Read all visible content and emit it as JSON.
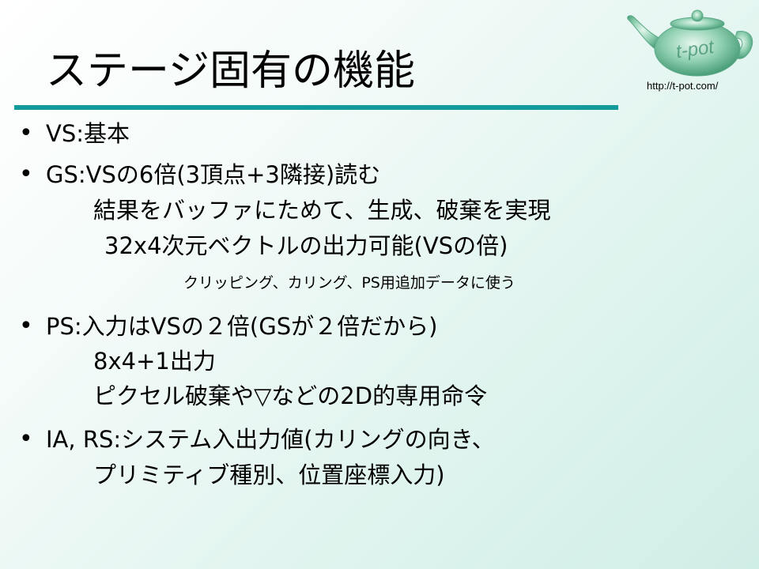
{
  "title": "ステージ固有の機能",
  "url": "http://t-pot.com/",
  "logo_text": "t-pot",
  "bullet_symbol": "•",
  "bullets": [
    {
      "lines": [
        "VS:基本"
      ]
    },
    {
      "lines": [
        "GS:VSの6倍(3頂点+3隣接)読む",
        "結果をバッファにためて、生成、破棄を実現",
        "32x4次元ベクトルの出力可能(VSの倍)",
        "クリッピング、カリング、PS用追加データに使う"
      ]
    },
    {
      "lines": [
        "PS:入力はVSの２倍(GSが２倍だから)",
        "8x4+1出力",
        "ピクセル破棄や▽などの2D的専用命令"
      ]
    },
    {
      "lines": [
        "IA, RS:システム入出力値(カリングの向き、",
        "プリミティブ種別、位置座標入力)"
      ]
    }
  ],
  "colors": {
    "accent": "#129b9a",
    "teapot": "#7fc9a6"
  }
}
